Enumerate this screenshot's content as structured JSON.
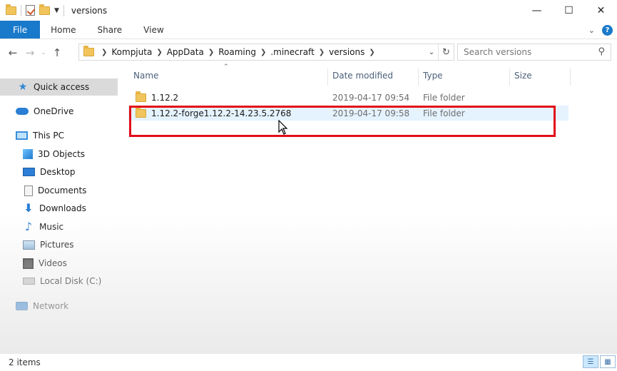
{
  "window": {
    "title": "versions",
    "controls": [
      "minimize",
      "maximize",
      "close"
    ]
  },
  "ribbon": {
    "tabs": [
      {
        "label": "File"
      },
      {
        "label": "Home"
      },
      {
        "label": "Share"
      },
      {
        "label": "View"
      }
    ]
  },
  "address": {
    "crumbs": [
      "Kompjuta",
      "AppData",
      "Roaming",
      ".minecraft",
      "versions"
    ]
  },
  "search": {
    "placeholder": "Search versions"
  },
  "sidebar": {
    "items": [
      {
        "label": "Quick access",
        "icon": "star-icon"
      },
      {
        "label": "OneDrive",
        "icon": "cloud-icon"
      },
      {
        "label": "This PC",
        "icon": "pc-icon"
      },
      {
        "label": "3D Objects",
        "icon": "cube-icon"
      },
      {
        "label": "Desktop",
        "icon": "desktop-icon"
      },
      {
        "label": "Documents",
        "icon": "document-icon"
      },
      {
        "label": "Downloads",
        "icon": "download-icon"
      },
      {
        "label": "Music",
        "icon": "music-icon"
      },
      {
        "label": "Pictures",
        "icon": "pictures-icon"
      },
      {
        "label": "Videos",
        "icon": "video-icon"
      },
      {
        "label": "Local Disk (C:)",
        "icon": "disk-icon"
      },
      {
        "label": "Network",
        "icon": "network-icon"
      }
    ]
  },
  "columns": {
    "name": "Name",
    "date": "Date modified",
    "type": "Type",
    "size": "Size"
  },
  "files": [
    {
      "name": "1.12.2",
      "date": "2019-04-17 09:54",
      "type": "File folder",
      "size": ""
    },
    {
      "name": "1.12.2-forge1.12.2-14.23.5.2768",
      "date": "2019-04-17 09:58",
      "type": "File folder",
      "size": ""
    }
  ],
  "status": {
    "item_count": "2 items"
  },
  "colors": {
    "accent": "#1979ca",
    "highlight_box": "#e20c19",
    "row_hover": "#e5f3ff"
  }
}
